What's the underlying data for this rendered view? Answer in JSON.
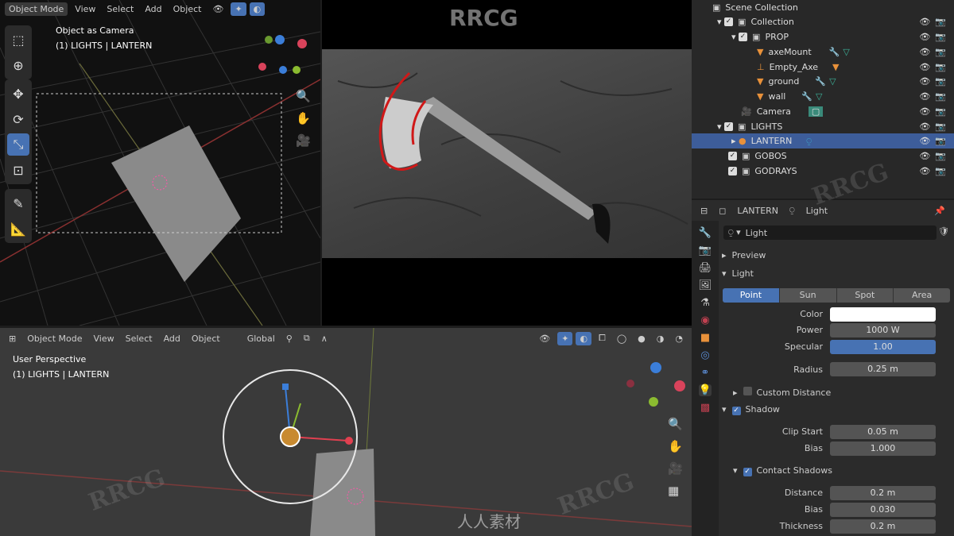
{
  "watermark": {
    "top": "RRCG",
    "repeat": "RRCG",
    "cn": "人人素材"
  },
  "top_left_viewport": {
    "mode": "Object Mode",
    "menus": [
      "View",
      "Select",
      "Add",
      "Object"
    ],
    "overlay_title": "Object as Camera",
    "overlay_sub": "(1) LIGHTS | LANTERN"
  },
  "bottom_viewport": {
    "mode": "Object Mode",
    "menus": [
      "View",
      "Select",
      "Add",
      "Object"
    ],
    "orientation": "Global",
    "overlay_title": "User Perspective",
    "overlay_sub": "(1) LIGHTS | LANTERN"
  },
  "outliner": {
    "root": "Scene Collection",
    "rows": [
      {
        "label": "Collection",
        "type": "collection"
      },
      {
        "label": "PROP",
        "type": "collection"
      },
      {
        "label": "axeMount",
        "type": "mesh"
      },
      {
        "label": "Empty_Axe",
        "type": "empty"
      },
      {
        "label": "ground",
        "type": "mesh"
      },
      {
        "label": "wall",
        "type": "mesh"
      },
      {
        "label": "Camera",
        "type": "camera"
      },
      {
        "label": "LIGHTS",
        "type": "collection"
      },
      {
        "label": "LANTERN",
        "type": "light",
        "selected": true
      },
      {
        "label": "GOBOS",
        "type": "collection"
      },
      {
        "label": "GODRAYS",
        "type": "collection"
      }
    ]
  },
  "properties": {
    "object": "LANTERN",
    "data": "Light",
    "datablock": "Light",
    "sections": {
      "preview": "Preview",
      "light": "Light",
      "custom_distance": "Custom Distance",
      "shadow": "Shadow",
      "contact_shadows": "Contact Shadows"
    },
    "types": [
      "Point",
      "Sun",
      "Spot",
      "Area"
    ],
    "active_type": "Point",
    "fields": {
      "color_label": "Color",
      "power_label": "Power",
      "power": "1000 W",
      "specular_label": "Specular",
      "specular": "1.00",
      "radius_label": "Radius",
      "radius": "0.25 m",
      "clip_start_label": "Clip Start",
      "clip_start": "0.05 m",
      "bias_label": "Bias",
      "bias": "1.000",
      "distance_label": "Distance",
      "distance": "0.2 m",
      "cbias_label": "Bias",
      "cbias": "0.030",
      "thickness_label": "Thickness",
      "thickness": "0.2 m"
    }
  },
  "colors": {
    "accent": "#4772b3",
    "selected": "#3d5d9a"
  }
}
